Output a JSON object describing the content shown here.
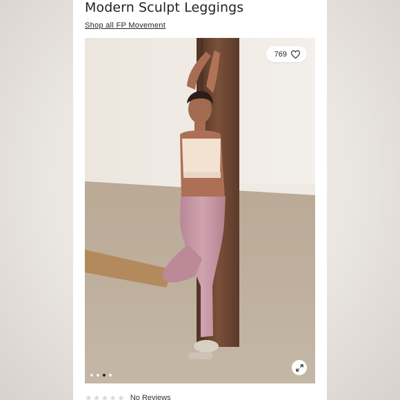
{
  "product": {
    "title": "Modern Sculpt Leggings",
    "shop_link": "Shop all FP Movement"
  },
  "gallery": {
    "favorites_count": "769",
    "favorite_icon": "heart-icon",
    "expand_icon": "expand-icon",
    "slide_count": 4,
    "active_slide": 3
  },
  "reviews": {
    "rating_stars": 0,
    "max_stars": 5,
    "label": "No Reviews"
  },
  "colors": {
    "text": "#222222",
    "legging": "#c99aa8",
    "bra": "#f1e2d2",
    "pillar": "#6b4632"
  }
}
